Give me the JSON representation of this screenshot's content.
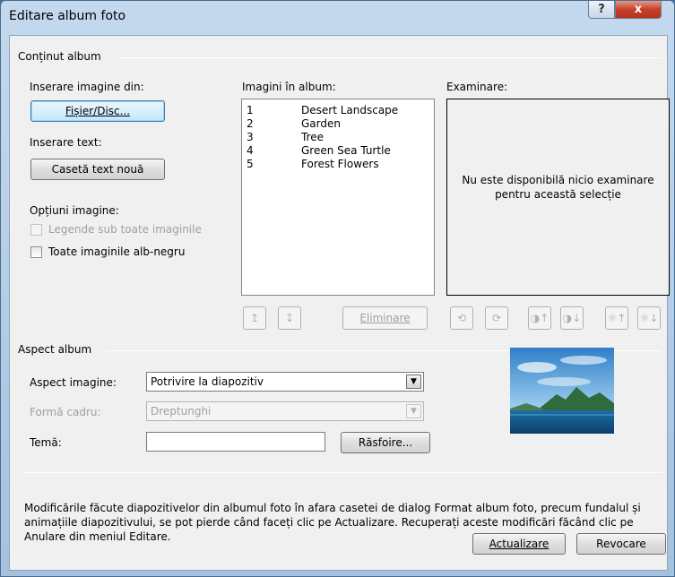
{
  "window": {
    "title": "Editare album foto",
    "help_glyph": "?",
    "close_glyph": "x"
  },
  "content_group": {
    "title": "Conținut album",
    "insert_images_label": "Inserare imagine din:",
    "file_disk_button": "Fișier/Disc...",
    "insert_text_label": "Inserare text:",
    "new_textbox_button": "Casetă text nouă",
    "image_options_label": "Opțiuni imagine:",
    "captions_checkbox": "Legende sub toate imaginile",
    "bw_checkbox": "Toate imaginile alb-negru",
    "album_pictures_label": "Imagini în album:",
    "pictures": [
      {
        "num": "1",
        "name": "Desert Landscape"
      },
      {
        "num": "2",
        "name": "Garden"
      },
      {
        "num": "3",
        "name": "Tree"
      },
      {
        "num": "4",
        "name": "Green Sea Turtle"
      },
      {
        "num": "5",
        "name": "Forest Flowers"
      }
    ],
    "remove_button": "Eliminare",
    "preview_label": "Examinare:",
    "preview_message": "Nu este disponibilă nicio examinare pentru această selecție",
    "move_up_glyph": "↥",
    "move_down_glyph": "↧",
    "rotate_left_glyph": "⟲",
    "rotate_right_glyph": "⟳",
    "contrast_up_glyph": "◑↑",
    "contrast_down_glyph": "◑↓",
    "brightness_up_glyph": "☼↑",
    "brightness_down_glyph": "☼↓"
  },
  "layout_group": {
    "title": "Aspect album",
    "picture_layout_label": "Aspect imagine:",
    "picture_layout_value": "Potrivire la diapozitiv",
    "frame_shape_label": "Formă cadru:",
    "frame_shape_value": "Dreptunghi",
    "theme_label": "Temă:",
    "theme_value": "",
    "browse_button": "Răsfoire...",
    "dropdown_glyph": "▼"
  },
  "note": "Modificările făcute diapozitivelor din albumul foto în afara casetei de dialog Format album foto, precum fundalul și animațiile diapozitivului, se pot pierde când faceți clic pe Actualizare. Recuperați aceste modificări făcând clic pe Anulare din meniul Editare.",
  "footer": {
    "update_button": "Actualizare",
    "cancel_button": "Revocare"
  }
}
